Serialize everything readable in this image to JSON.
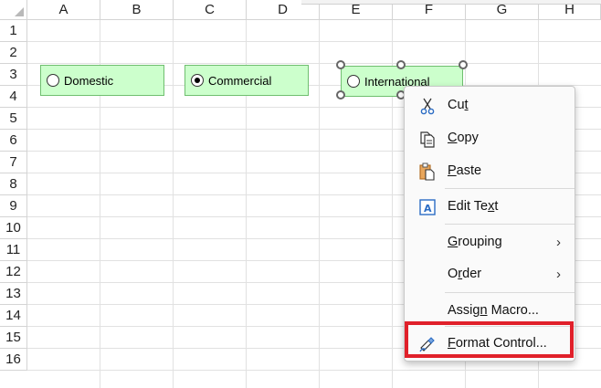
{
  "columns": [
    "A",
    "B",
    "C",
    "D",
    "E",
    "F",
    "G",
    "H"
  ],
  "rows": [
    "1",
    "2",
    "3",
    "4",
    "5",
    "6",
    "7",
    "8",
    "9",
    "10",
    "11",
    "12",
    "13",
    "14",
    "15",
    "16"
  ],
  "radio_buttons": [
    {
      "label": "Domestic",
      "checked": false
    },
    {
      "label": "Commercial",
      "checked": true
    },
    {
      "label": "International",
      "checked": false
    }
  ],
  "context_menu": {
    "items": [
      {
        "id": "cut",
        "pre": "Cu",
        "key": "t",
        "post": ""
      },
      {
        "id": "copy",
        "pre": "",
        "key": "C",
        "post": "opy"
      },
      {
        "id": "paste",
        "pre": "",
        "key": "P",
        "post": "aste"
      },
      {
        "id": "edit-text",
        "pre": "Edit Te",
        "key": "x",
        "post": "t"
      },
      {
        "id": "grouping",
        "pre": "",
        "key": "G",
        "post": "rouping",
        "submenu": true
      },
      {
        "id": "order",
        "pre": "O",
        "key": "r",
        "post": "der",
        "submenu": true
      },
      {
        "id": "assign-macro",
        "pre": "Assig",
        "key": "n",
        "post": " Macro..."
      },
      {
        "id": "format-control",
        "pre": "",
        "key": "F",
        "post": "ormat Control..."
      }
    ],
    "submenu_arrow": "›"
  },
  "colors": {
    "radio_fill": "#ccffcc",
    "highlight": "#e0202a"
  }
}
